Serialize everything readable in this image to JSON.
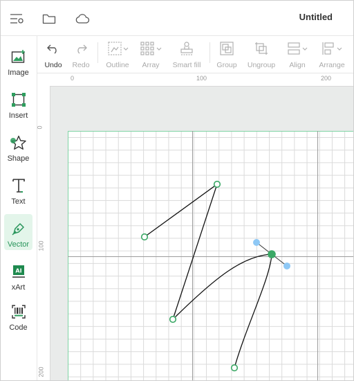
{
  "app": {
    "document_title": "Untitled",
    "top_icons": [
      "menu-settings-icon",
      "folder-icon",
      "cloud-icon"
    ]
  },
  "sidebar": {
    "items": [
      {
        "label": "Image",
        "icon": "image-icon",
        "active": false
      },
      {
        "label": "Insert",
        "icon": "insert-icon",
        "active": false
      },
      {
        "label": "Shape",
        "icon": "shape-icon",
        "active": false
      },
      {
        "label": "Text",
        "icon": "text-icon",
        "active": false
      },
      {
        "label": "Vector",
        "icon": "vector-pen-icon",
        "active": true
      },
      {
        "label": "xArt",
        "icon": "xart-icon",
        "active": false
      },
      {
        "label": "Code",
        "icon": "code-icon",
        "active": false
      }
    ]
  },
  "toolbar": {
    "items": [
      {
        "label": "Undo",
        "icon": "undo-icon",
        "enabled": true
      },
      {
        "label": "Redo",
        "icon": "redo-icon",
        "enabled": false
      },
      {
        "label": "Outline",
        "icon": "outline-icon",
        "enabled": false
      },
      {
        "label": "Array",
        "icon": "array-icon",
        "enabled": false
      },
      {
        "label": "Smart fill",
        "icon": "smart-fill-icon",
        "enabled": false
      },
      {
        "label": "Group",
        "icon": "group-icon",
        "enabled": false
      },
      {
        "label": "Ungroup",
        "icon": "ungroup-icon",
        "enabled": false
      },
      {
        "label": "Align",
        "icon": "align-icon",
        "enabled": false
      },
      {
        "label": "Arrange",
        "icon": "arrange-icon",
        "enabled": false
      }
    ]
  },
  "rulers": {
    "top_labels": [
      "0",
      "100",
      "200"
    ],
    "left_labels": [
      "0",
      "100",
      "200"
    ]
  },
  "colors": {
    "accent": "#27945a",
    "active_bg": "#e3f5ea",
    "anchor_stroke": "#3aa865",
    "handle_fill": "#8ec8f5",
    "page_border": "#7fd4a4"
  }
}
